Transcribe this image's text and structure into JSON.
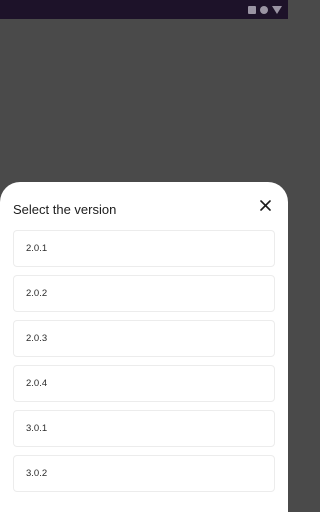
{
  "status_bar": {
    "icons": [
      "square-icon",
      "circle-icon",
      "triangle-icon"
    ],
    "background": "#1d1229"
  },
  "sheet": {
    "title": "Select the version",
    "close_icon": "close-icon",
    "versions": [
      "2.0.1",
      "2.0.2",
      "2.0.3",
      "2.0.4",
      "3.0.1",
      "3.0.2"
    ]
  },
  "colors": {
    "scrim": "#4a4a4a",
    "sheet": "#ffffff",
    "item_border": "#ececec",
    "text": "#1c1c1c"
  }
}
